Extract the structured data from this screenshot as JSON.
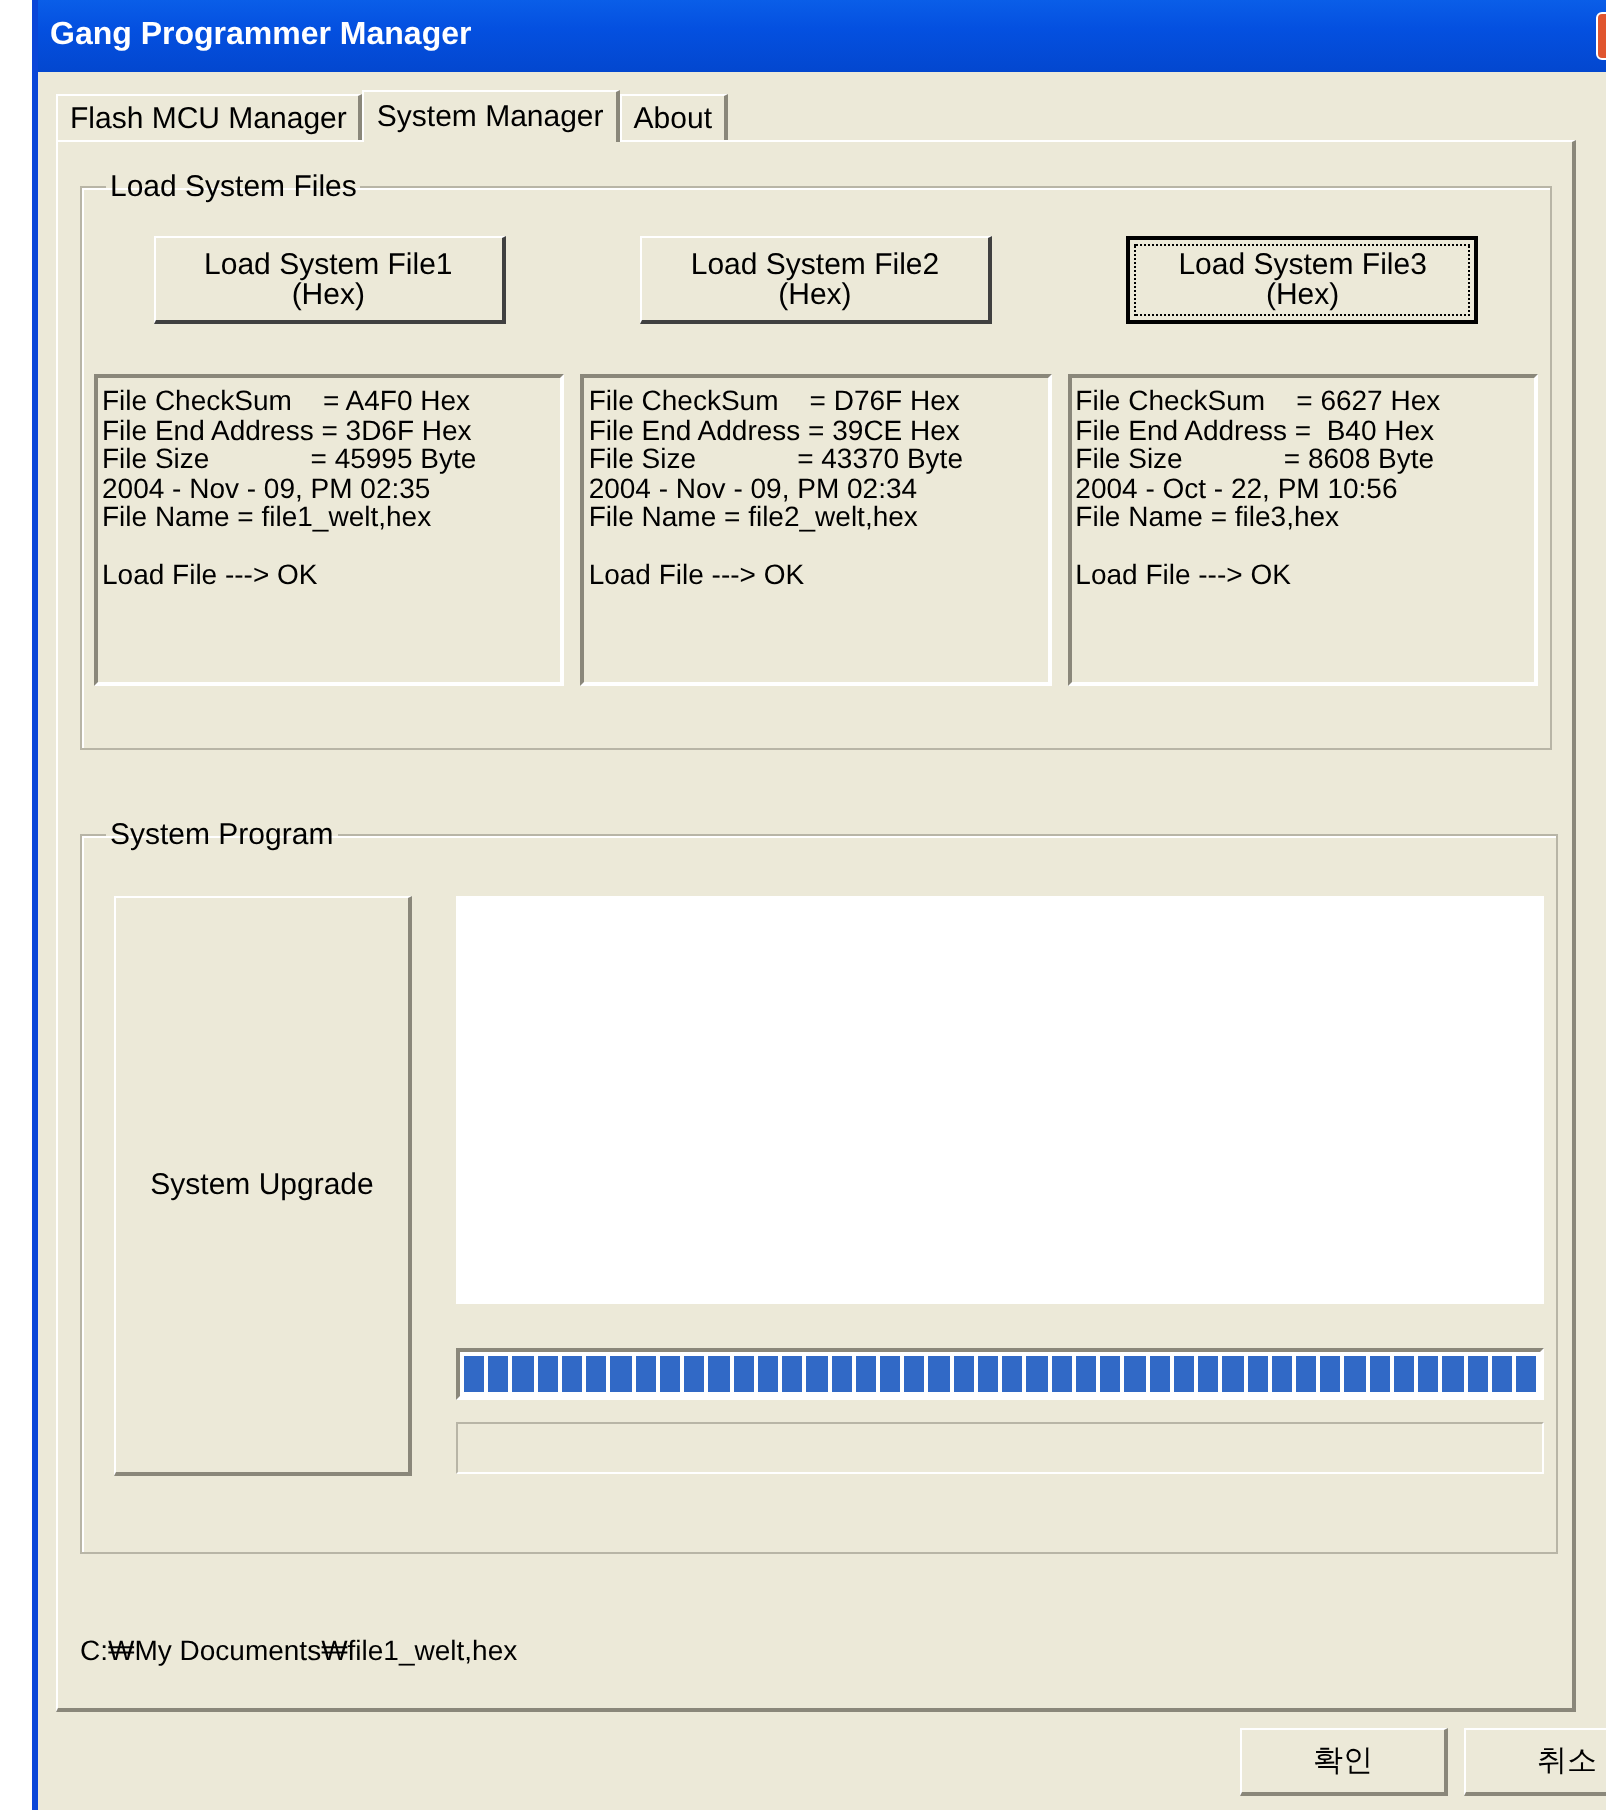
{
  "window": {
    "title": "Gang Programmer Manager"
  },
  "tabs": [
    {
      "label": "Flash MCU Manager",
      "selected": false
    },
    {
      "label": "System Manager",
      "selected": true
    },
    {
      "label": "About",
      "selected": false
    }
  ],
  "load_system_files": {
    "title": "Load System Files",
    "files": [
      {
        "button": {
          "label": "Load System File1",
          "sublabel": "(Hex)",
          "focused": false
        },
        "info_lines": [
          "File CheckSum    = A4F0 Hex",
          "File End Address = 3D6F Hex",
          "File Size             = 45995 Byte",
          "2004 - Nov - 09, PM 02:35",
          "File Name = file1_welt,hex"
        ],
        "result": "Load File ---> OK"
      },
      {
        "button": {
          "label": "Load System File2",
          "sublabel": "(Hex)",
          "focused": false
        },
        "info_lines": [
          "File CheckSum    = D76F Hex",
          "File End Address = 39CE Hex",
          "File Size             = 43370 Byte",
          "2004 - Nov - 09, PM 02:34",
          "File Name = file2_welt,hex"
        ],
        "result": "Load File ---> OK"
      },
      {
        "button": {
          "label": "Load System File3",
          "sublabel": "(Hex)",
          "focused": true
        },
        "info_lines": [
          "File CheckSum    = 6627 Hex",
          "File End Address =  B40 Hex",
          "File Size             = 8608 Byte",
          "2004 - Oct - 22, PM 10:56",
          "File Name = file3,hex"
        ],
        "result": "Load File ---> OK"
      }
    ]
  },
  "system_program": {
    "title": "System Program",
    "upgrade_button": "System Upgrade",
    "progress": {
      "level": 1
    }
  },
  "path": "C:₩My Documents₩file1_welt,hex",
  "buttons": [
    "확인",
    "취소"
  ]
}
